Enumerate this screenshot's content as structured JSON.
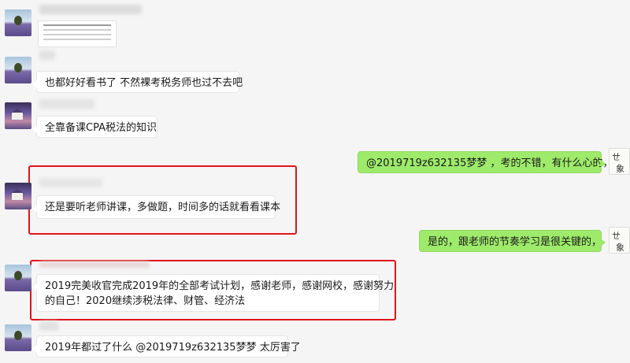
{
  "messages": [
    {
      "side": "left",
      "text": "也都好好看书了 不然裸考税务师也过不去吧"
    },
    {
      "side": "left",
      "text": "全靠备课CPA税法的知识"
    },
    {
      "side": "right",
      "text": "@2019719z632135梦梦 ，考的不错，有什么心的，"
    },
    {
      "side": "left",
      "text": "还是要听老师讲课，多做题，时间多的话就看看课本"
    },
    {
      "side": "right",
      "text": "是的，跟老师的节奏学习是很关键的，"
    },
    {
      "side": "left",
      "line1": "2019完美收官完成2019年的全部考试计划，感谢老师，感谢网校，感谢努力",
      "line2": "的自己！2020继续涉税法律、财管、经济法"
    },
    {
      "side": "left",
      "text": "2019年都过了什么 @2019719z632135梦梦   太厉害了"
    }
  ],
  "colors": {
    "background": "#f5f5f5",
    "self_bubble": "#9eea6a",
    "other_bubble": "#ffffff",
    "highlight_box": "#e0141b"
  },
  "icons": {
    "avatar_a": "lavender-field-avatar-icon",
    "avatar_b": "house-photo-avatar-icon",
    "avatar_self": "ink-calligraphy-avatar-icon"
  }
}
